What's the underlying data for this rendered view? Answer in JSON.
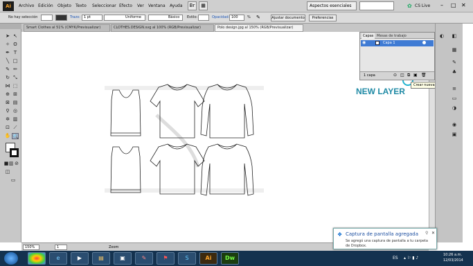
{
  "app": {
    "logo": "Ai",
    "workspace": "Aspectos esenciales",
    "cs_live": "CS Live"
  },
  "menu": [
    "Archivo",
    "Edición",
    "Objeto",
    "Texto",
    "Seleccionar",
    "Efecto",
    "Ver",
    "Ventana",
    "Ayuda"
  ],
  "control": {
    "selection": "No hay selección",
    "stroke_label": "Trazo:",
    "stroke_value": "1 pt",
    "uniform": "Uniforme",
    "basic": "Básico",
    "style_label": "Estilo:",
    "opacity_label": "Opacidad:",
    "opacity_value": "100",
    "opacity_unit": "%",
    "adjust_button": "Ajustar documento",
    "prefs_button": "Preferencias"
  },
  "tabs": [
    "Smart Clothes al 51% (CMYK/Previsualizar)",
    "CLOTHES.DESIGN.svg al 100% (RGB/Previsualizar)",
    "Polo design.jpg al 150% (RGB/Previsualizar)"
  ],
  "layers": {
    "tab_layers": "Capas",
    "tab_artboards": "Mesas de trabajo",
    "layer_name": "Capa 1",
    "count": "1 capa",
    "tooltip": "Crear nueva capa"
  },
  "annotation": {
    "text": "NEW LAYER",
    "color": "#1f8aa5"
  },
  "status": {
    "zoom": "150%",
    "page": "1",
    "mode": "Zoom"
  },
  "toast": {
    "title": "Captura de pantalla agregada",
    "body": "Se agregó una captura de pantalla a tu carpeta de Dropbox."
  },
  "taskbar": {
    "lang": "ES",
    "time": "10:26 a.m.",
    "date": "12/03/2014",
    "apps": [
      "Ai",
      "Dw"
    ]
  }
}
